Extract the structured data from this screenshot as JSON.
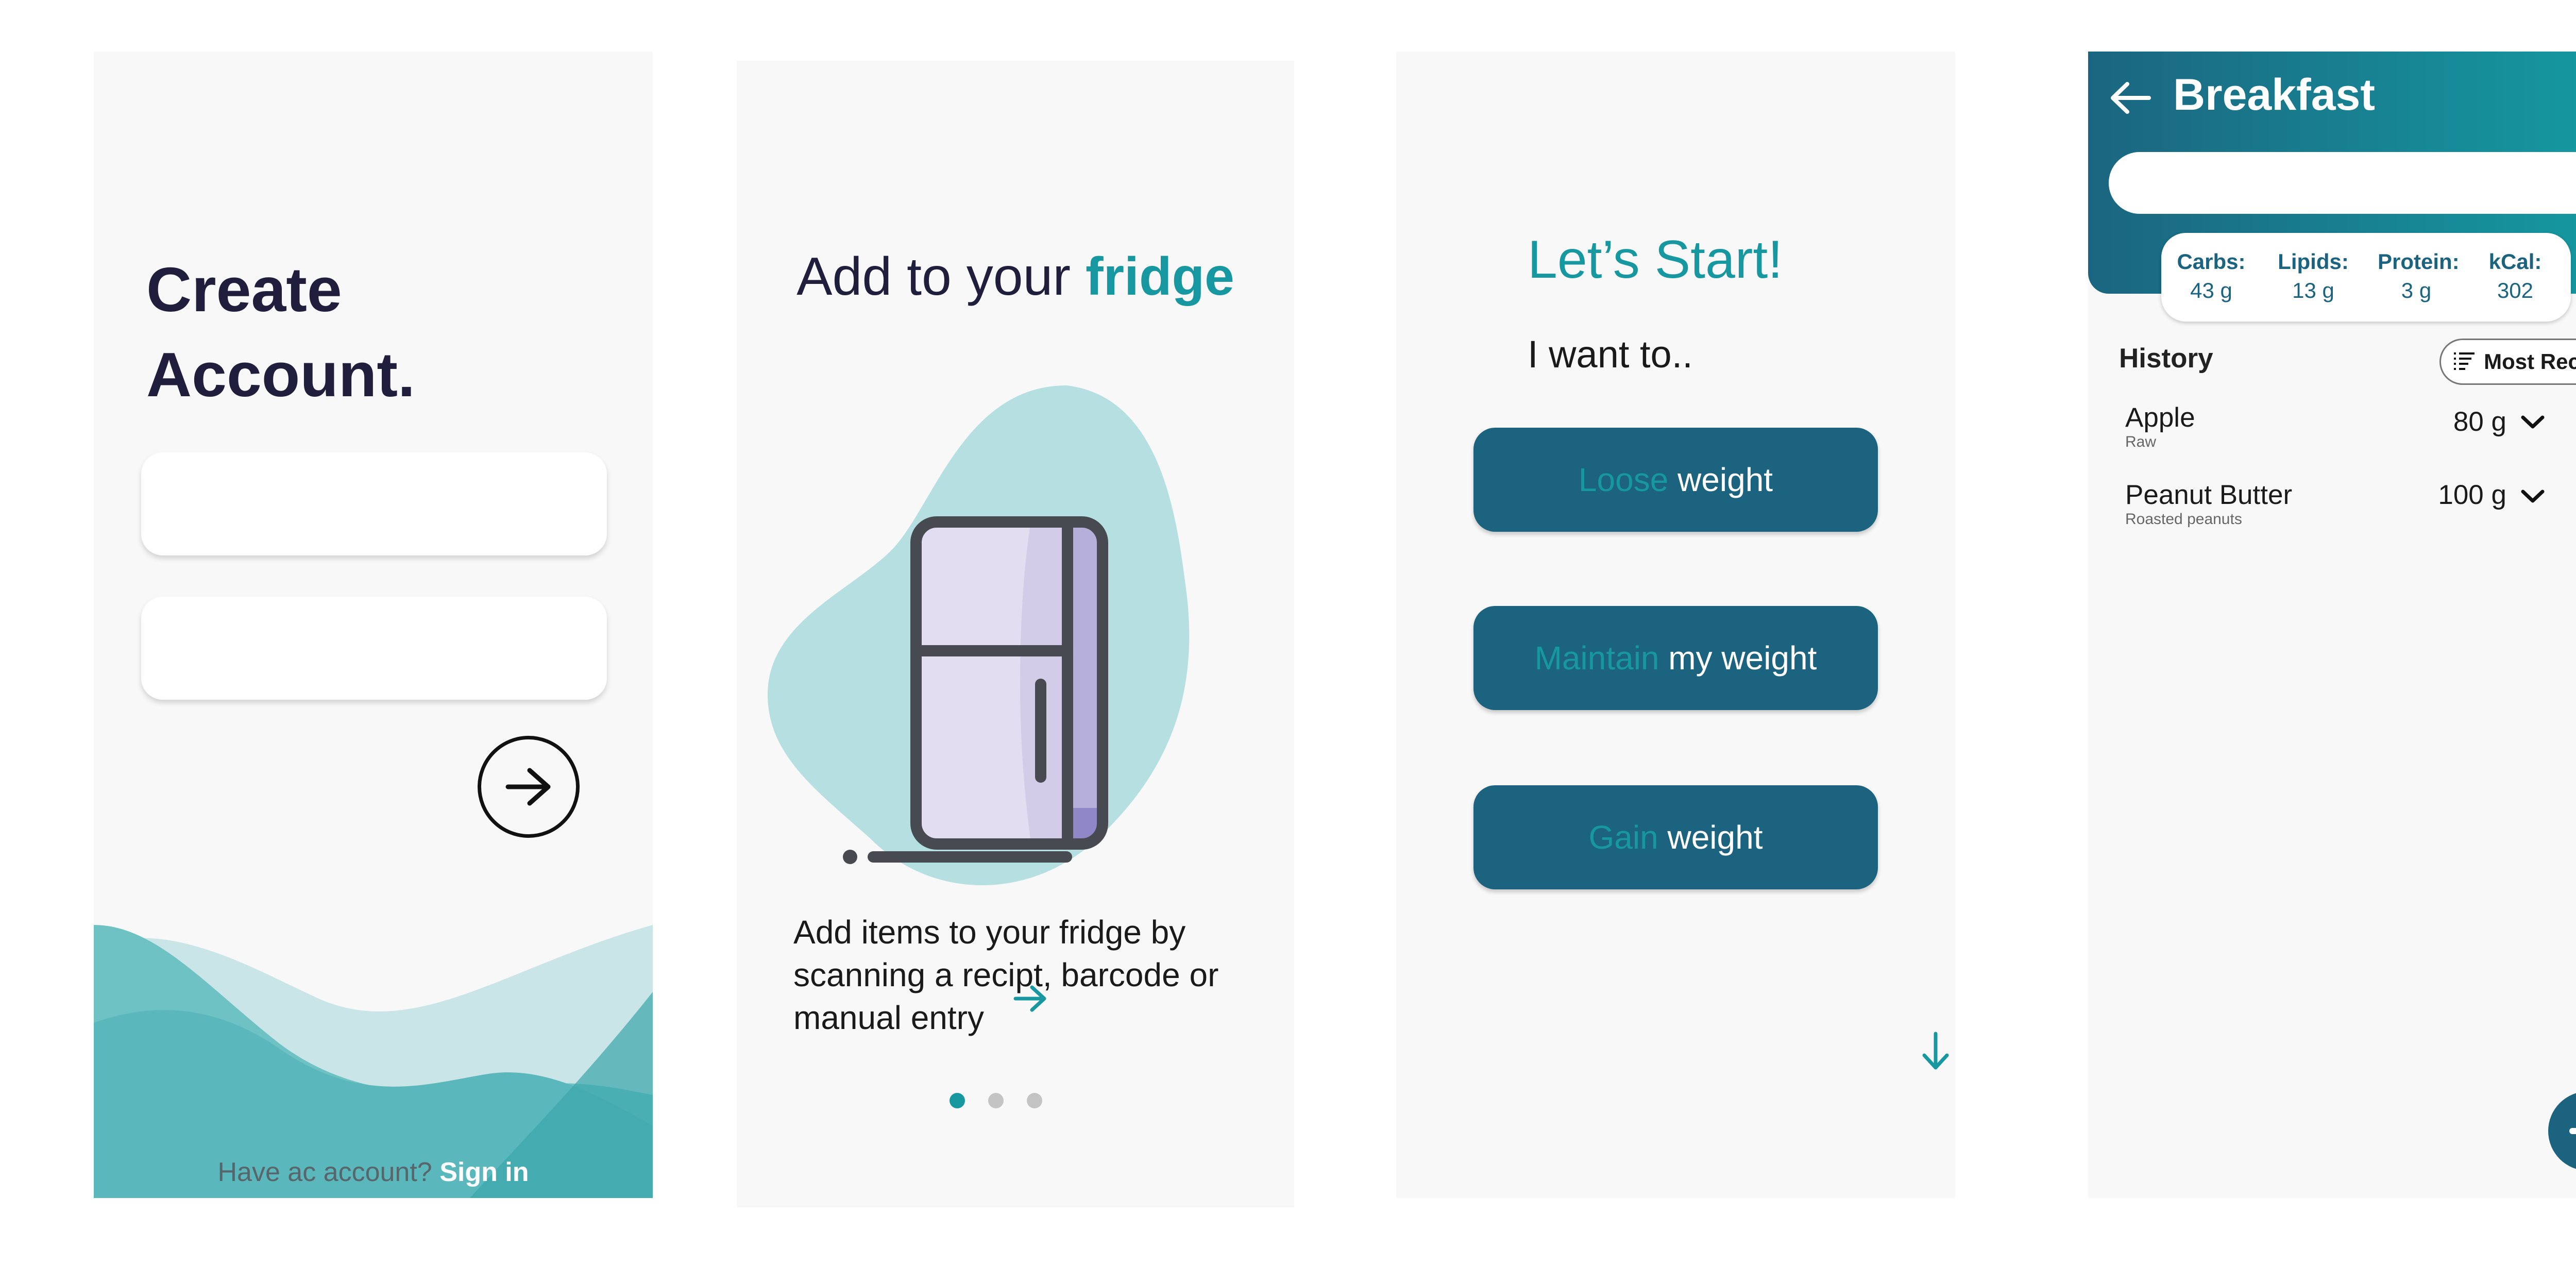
{
  "screen1": {
    "title_line1": "Create",
    "title_line2": "Account.",
    "signin_prompt": "Have ac account?",
    "signin_link": "Sign in"
  },
  "screen2": {
    "title_prefix": "Add to your ",
    "title_accent": "fridge",
    "description": "Add items to your fridge by scanning a recipt, barcode or manual entry",
    "page_dots": 3,
    "active_dot": 0
  },
  "screen3": {
    "title": "Let’s Start!",
    "prompt": "I want to..",
    "options": [
      {
        "accent": "Loose",
        "rest": " weight"
      },
      {
        "accent": "Maintain",
        "rest": " my weight"
      },
      {
        "accent": "Gain",
        "rest": " weight"
      }
    ]
  },
  "screen4": {
    "title": "Breakfast",
    "search_value": "",
    "macros": [
      {
        "label": "Carbs:",
        "value": "43 g"
      },
      {
        "label": "Lipids:",
        "value": "13 g"
      },
      {
        "label": "Protein:",
        "value": "3 g"
      },
      {
        "label": "kCal:",
        "value": "302"
      }
    ],
    "history_label": "History",
    "sort_label": "Most Recent",
    "items": [
      {
        "name": "Apple",
        "sub": "Raw",
        "qty": "80 g",
        "checked": true
      },
      {
        "name": "Peanut Butter",
        "sub": "Roasted peanuts",
        "qty": "100 g",
        "checked": false
      }
    ]
  },
  "colors": {
    "accent": "#17979f",
    "primary": "#1c6380",
    "dark_text": "#1f1f3d",
    "wave_light": "#c9e5e7",
    "wave_mid": "#5fbcc0"
  },
  "icons": [
    "arrow-right-icon",
    "fridge-illustration",
    "arrow-down-icon",
    "back-arrow-icon",
    "search-icon",
    "sort-list-icon",
    "chevron-down-icon",
    "checkmark-icon",
    "plus-icon"
  ]
}
